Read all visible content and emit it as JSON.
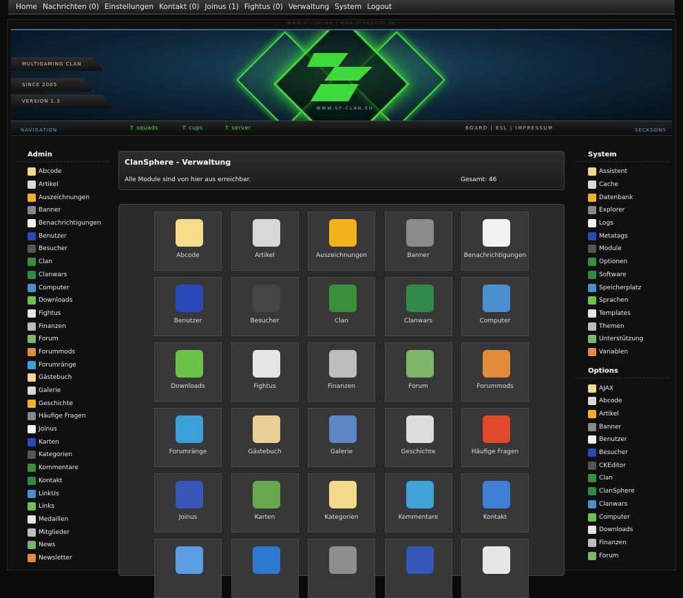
{
  "topnav": [
    "Home",
    "Nachrichten (0)",
    "Einstellungen",
    "Kontakt (0)",
    "Joinus (1)",
    "Fightus (0)",
    "Verwaltung",
    "System",
    "Logout"
  ],
  "header": {
    "url_strip": "www.sf-clan.eu | www.sf-esports.de",
    "tags": [
      "MULTIGAMING CLAN",
      "SINCE 2005",
      "VERSION 1.3"
    ],
    "logo_url": "WWW.SF-CLAN.EU",
    "logo_color": "#3ed93a"
  },
  "subnav": {
    "left": [
      "squads",
      "cups",
      "server"
    ],
    "right": "BOARD | ESL | IMPRESSUM",
    "nav_left_label": "NAVIGATION",
    "nav_right_label": "SECKSONS"
  },
  "sidebar_left": {
    "title": "Admin",
    "items": [
      "Abcode",
      "Artikel",
      "Auszeichnungen",
      "Banner",
      "Benachrichtigungen",
      "Benutzer",
      "Besucher",
      "Clan",
      "Clanwars",
      "Computer",
      "Downloads",
      "Fightus",
      "Finanzen",
      "Forum",
      "Forummods",
      "Forumränge",
      "Gästebuch",
      "Galerie",
      "Geschichte",
      "Häufige Fragen",
      "Joinus",
      "Karten",
      "Kategorien",
      "Kommentare",
      "Kontakt",
      "LinkUs",
      "Links",
      "Medaillen",
      "Mitglieder",
      "News",
      "Newsletter"
    ]
  },
  "sidebar_right": {
    "system_title": "System",
    "system_items": [
      "Assistent",
      "Cache",
      "Datenbank",
      "Explorer",
      "Logs",
      "Metatags",
      "Module",
      "Optionen",
      "Software",
      "Speicherplatz",
      "Sprachen",
      "Templates",
      "Themen",
      "Unterstützung",
      "Variablen"
    ],
    "options_title": "Options",
    "options_items": [
      "AJAX",
      "Abcode",
      "Artikel",
      "Banner",
      "Benutzer",
      "Besucher",
      "CKEditor",
      "Clan",
      "ClanSphere",
      "Clanwars",
      "Computer",
      "Downloads",
      "Finanzen",
      "Forum"
    ]
  },
  "main": {
    "title": "ClanSphere - Verwaltung",
    "description": "Alle Module sind von hier aus erreichbar.",
    "total": "Gesamt: 46",
    "tiles": [
      "Abcode",
      "Artikel",
      "Auszeichnungen",
      "Banner",
      "Benachrichtigungen",
      "Benutzer",
      "Besucher",
      "Clan",
      "Clanwars",
      "Computer",
      "Downloads",
      "Fightus",
      "Finanzen",
      "Forum",
      "Forummods",
      "Forumränge",
      "Gästebuch",
      "Galerie",
      "Geschichte",
      "Häufige Fragen",
      "Joinus",
      "Karten",
      "Kategorien",
      "Kommentare",
      "Kontakt",
      "",
      "",
      "",
      "",
      ""
    ],
    "tile_icons": [
      "abcode-icon",
      "artikel-icon",
      "star-icon",
      "banner-icon",
      "paper-plane-icon",
      "user-icon",
      "clock-icon",
      "users-icon",
      "radar-icon",
      "computer-icon",
      "download-icon",
      "checkerboard-icon",
      "calculator-icon",
      "board-icon",
      "group-icon",
      "ranks-icon",
      "guestbook-icon",
      "photo-icon",
      "document-icon",
      "lifebuoy-icon",
      "user-add-icon",
      "map-icon",
      "folder-icon",
      "speech-bubbles-icon",
      "contact-icon",
      "linkus-icon",
      "globe-icon",
      "medal-icon",
      "user-star-icon",
      "newspaper-icon"
    ],
    "tile_colors": [
      "#f4dd8a",
      "#d8d8d8",
      "#f3b41b",
      "#8a8a8a",
      "#f2f2f2",
      "#2a49b8",
      "#444444",
      "#3a8f3a",
      "#2f8a4a",
      "#4c8fcf",
      "#6cc24a",
      "#e5e5e5",
      "#bdbdbd",
      "#7db56b",
      "#e08c3a",
      "#3aa0d8",
      "#e8cf95",
      "#5b87c9",
      "#dcdcdc",
      "#e04a2a",
      "#3557b8",
      "#6aa84f",
      "#f2d98a",
      "#3fa3d8",
      "#3f7fd8",
      "#5a9de0",
      "#2e79d2",
      "#8e8e8e",
      "#3557b8",
      "#e6e6e6"
    ]
  },
  "colors": {
    "accent_green": "#5fdc47",
    "accent_blue": "#4aa8e0"
  }
}
